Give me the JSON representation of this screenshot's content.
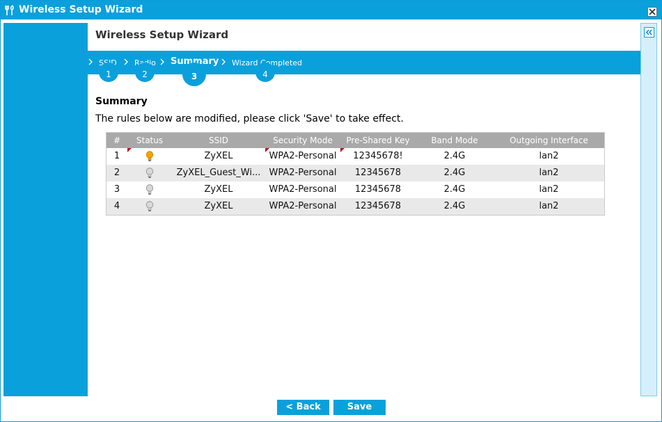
{
  "window": {
    "title": "Wireless Setup Wizard"
  },
  "content": {
    "title": "Wireless Setup Wizard"
  },
  "steps": [
    {
      "label": "SSID",
      "number": "1",
      "active": false
    },
    {
      "label": "Radio",
      "number": "2",
      "active": false
    },
    {
      "label": "Summary",
      "number": "3",
      "active": true
    },
    {
      "label": "Wizard Completed",
      "number": "4",
      "active": false
    }
  ],
  "summary": {
    "heading": "Summary",
    "description": "The rules below are modified, please click 'Save' to take effect."
  },
  "table": {
    "columns": [
      "#",
      "Status",
      "SSID",
      "Security Mode",
      "Pre-Shared Key",
      "Band Mode",
      "Outgoing Interface"
    ],
    "rows": [
      {
        "num": "1",
        "status": "on",
        "ssid": "ZyXEL",
        "security": "WPA2-Personal",
        "psk": "12345678!",
        "band": "2.4G",
        "out": "lan2"
      },
      {
        "num": "2",
        "status": "off",
        "ssid": "ZyXEL_Guest_Wi...",
        "security": "WPA2-Personal",
        "psk": "12345678",
        "band": "2.4G",
        "out": "lan2"
      },
      {
        "num": "3",
        "status": "off",
        "ssid": "ZyXEL",
        "security": "WPA2-Personal",
        "psk": "12345678",
        "band": "2.4G",
        "out": "lan2"
      },
      {
        "num": "4",
        "status": "off",
        "ssid": "ZyXEL",
        "security": "WPA2-Personal",
        "psk": "12345678",
        "band": "2.4G",
        "out": "lan2"
      }
    ]
  },
  "buttons": {
    "back": "< Back",
    "save": "Save"
  },
  "icons": {
    "title": "wizard-tools-icon",
    "close": "close-icon",
    "collapse": "double-chevron-left-icon",
    "status_on": "lightbulb-on-icon",
    "status_off": "lightbulb-off-icon"
  },
  "colors": {
    "accent": "#0aa0dc",
    "bulb_on": "#f5a300",
    "bulb_off": "#9a9a9a",
    "modified_marker": "#c01020"
  }
}
